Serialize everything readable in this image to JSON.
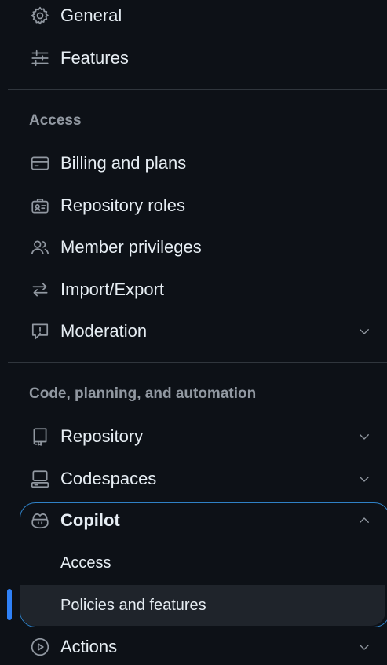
{
  "nav": {
    "general": "General",
    "features": "Features",
    "access_heading": "Access",
    "billing": "Billing and plans",
    "repo_roles": "Repository roles",
    "member_privileges": "Member privileges",
    "import_export": "Import/Export",
    "moderation": "Moderation",
    "code_heading": "Code, planning, and automation",
    "repository": "Repository",
    "codespaces": "Codespaces",
    "copilot": "Copilot",
    "copilot_access": "Access",
    "copilot_policies": "Policies and features",
    "actions": "Actions"
  },
  "icons": {
    "general": "gear-icon",
    "features": "sliders-icon",
    "billing": "credit-card-icon",
    "repo_roles": "id-badge-icon",
    "member_privileges": "people-icon",
    "import_export": "arrow-switch-icon",
    "moderation": "report-icon",
    "repository": "repo-icon",
    "codespaces": "codespaces-icon",
    "copilot": "copilot-icon",
    "actions": "play-icon"
  },
  "colors": {
    "background": "#0d1117",
    "text": "#e6edf3",
    "muted": "#9198a1",
    "divider": "#30363d",
    "accent": "#2f81f7",
    "group_border": "#2f81c6"
  }
}
